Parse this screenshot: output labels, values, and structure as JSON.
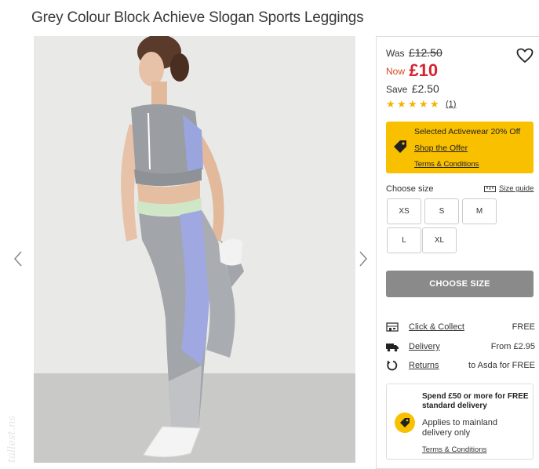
{
  "product": {
    "title": "Grey Colour Block Achieve Slogan Sports Leggings"
  },
  "price": {
    "was_label": "Was",
    "was_value": "£12.50",
    "now_label": "Now",
    "now_value": "£10",
    "save_label": "Save",
    "save_value": "£2.50"
  },
  "rating": {
    "stars": 5,
    "reviews": "(1)"
  },
  "offer": {
    "headline": "Selected Activewear 20% Off",
    "shop_link": "Shop the Offer",
    "terms_link": "Terms & Conditions",
    "bg_color": "#f9c000"
  },
  "size": {
    "label": "Choose size",
    "guide_link": "Size guide",
    "options": [
      "XS",
      "S",
      "M",
      "L",
      "XL"
    ]
  },
  "choose_button": "CHOOSE SIZE",
  "delivery": [
    {
      "icon": "store-icon",
      "label": "Click & Collect",
      "value": "FREE"
    },
    {
      "icon": "truck-icon",
      "label": "Delivery",
      "value": "From £2.95"
    },
    {
      "icon": "return-icon",
      "label": "Returns",
      "value": "to Asda for FREE"
    }
  ],
  "spend": {
    "headline": "Spend £50 or more for FREE standard delivery",
    "note": "Applies to mainland delivery only",
    "terms_link": "Terms & Conditions"
  },
  "colors": {
    "price_red": "#d3242f",
    "star": "#f5b400",
    "button_grey": "#8a8a8a"
  }
}
